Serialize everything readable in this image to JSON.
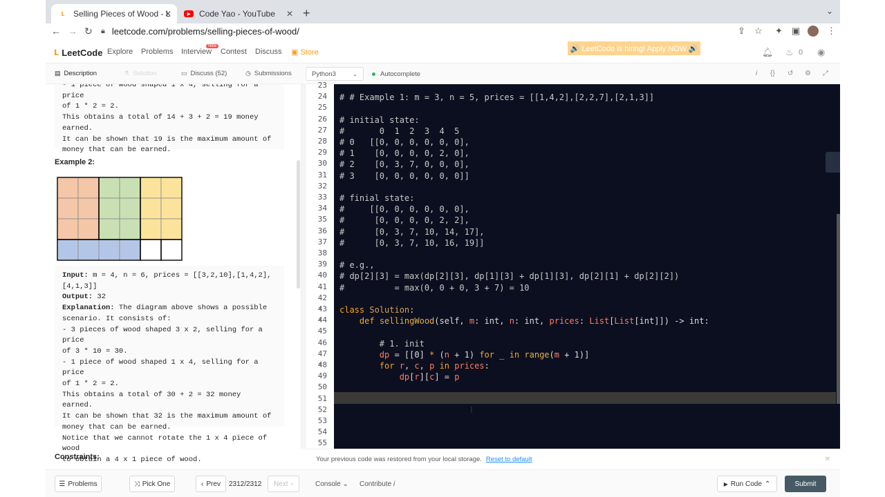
{
  "browser": {
    "tabs": [
      {
        "title": "Selling Pieces of Wood - LeetC",
        "active": true,
        "favicon": "leetcode-icon"
      },
      {
        "title": "Code Yao - YouTube",
        "active": false,
        "favicon": "youtube-icon"
      }
    ],
    "url": "leetcode.com/problems/selling-pieces-of-wood/"
  },
  "nav": {
    "logo": "LeetCode",
    "links": [
      "Explore",
      "Problems",
      "Interview",
      "Contest",
      "Discuss",
      "Store"
    ],
    "new_badge": "New",
    "hiring": "🔊 LeetCode is hiring! Apply NOW.🔊",
    "streak": "0"
  },
  "desc_tabs": {
    "description": "Description",
    "solution": "Solution",
    "discuss": "Discuss (52)",
    "submissions": "Submissions"
  },
  "editor_toolbar": {
    "language": "Python3",
    "autocomplete": "Autocomplete"
  },
  "description": {
    "example1_tail": "- 1 piece of wood shaped 1 x 4, selling for a price\nof 1 * 2 = 2.\nThis obtains a total of 14 + 3 + 2 = 19 money\nearned.\nIt can be shown that 19 is the maximum amount of\nmoney that can be earned.",
    "example2_heading": "Example 2:",
    "example2_input_label": "Input:",
    "example2_input": " m = 4, n = 6, prices = [[3,2,10],[1,4,2],\n[4,1,3]]",
    "example2_output_label": "Output:",
    "example2_output": " 32",
    "example2_expl_label": "Explanation:",
    "example2_expl": " The diagram above shows a possible\nscenario. It consists of:\n- 3 pieces of wood shaped 3 x 2, selling for a price\nof 3 * 10 = 30.\n- 1 piece of wood shaped 1 x 4, selling for a price\nof 1 * 2 = 2.\nThis obtains a total of 30 + 2 = 32 money earned.\nIt can be shown that 32 is the maximum amount of\nmoney that can be earned.\nNotice that we cannot rotate the 1 x 4 piece of wood\nto obtain a 4 x 1 piece of wood.",
    "constraints_heading": "Constraints:"
  },
  "code_lines": [
    {
      "n": "23",
      "tokens": []
    },
    {
      "n": "24",
      "tokens": [
        [
          "c-com",
          "# # Example 1: m = 3, n = 5, prices = [[1,4,2],[2,2,7],[2,1,3]]"
        ]
      ]
    },
    {
      "n": "25",
      "tokens": []
    },
    {
      "n": "26",
      "tokens": [
        [
          "c-com",
          "# initial state:"
        ]
      ]
    },
    {
      "n": "27",
      "tokens": [
        [
          "c-com",
          "#       0  1  2  3  4  5"
        ]
      ]
    },
    {
      "n": "28",
      "tokens": [
        [
          "c-com",
          "# 0   [[0, 0, 0, 0, 0, 0],"
        ]
      ]
    },
    {
      "n": "29",
      "tokens": [
        [
          "c-com",
          "# 1    [0, 0, 0, 0, 2, 0],"
        ]
      ]
    },
    {
      "n": "30",
      "tokens": [
        [
          "c-com",
          "# 2    [0, 3, 7, 0, 0, 0],"
        ]
      ]
    },
    {
      "n": "31",
      "tokens": [
        [
          "c-com",
          "# 3    [0, 0, 0, 0, 0, 0]]"
        ]
      ]
    },
    {
      "n": "32",
      "tokens": []
    },
    {
      "n": "33",
      "tokens": [
        [
          "c-com",
          "# finial state:"
        ]
      ]
    },
    {
      "n": "34",
      "tokens": [
        [
          "c-com",
          "#     [[0, 0, 0, 0, 0, 0],"
        ]
      ]
    },
    {
      "n": "35",
      "tokens": [
        [
          "c-com",
          "#      [0, 0, 0, 0, 2, 2],"
        ]
      ]
    },
    {
      "n": "36",
      "tokens": [
        [
          "c-com",
          "#      [0, 3, 7, 10, 14, 17],"
        ]
      ]
    },
    {
      "n": "37",
      "tokens": [
        [
          "c-com",
          "#      [0, 3, 7, 10, 16, 19]]"
        ]
      ]
    },
    {
      "n": "38",
      "tokens": []
    },
    {
      "n": "39",
      "tokens": [
        [
          "c-com",
          "# e.g.,"
        ]
      ]
    },
    {
      "n": "40",
      "tokens": [
        [
          "c-com",
          "# dp[2][3] = max(dp[2][3], dp[1][3] + dp[1][3], dp[2][1] + dp[2][2])"
        ]
      ]
    },
    {
      "n": "41",
      "tokens": [
        [
          "c-com",
          "#          = max(0, 0 + 0, 3 + 7) = 10"
        ]
      ]
    },
    {
      "n": "42",
      "tokens": []
    },
    {
      "n": "43",
      "fold": true,
      "tokens": [
        [
          "c-kw",
          "class "
        ],
        [
          "c-cls",
          "Solution"
        ],
        [
          "c-pl",
          ":"
        ]
      ]
    },
    {
      "n": "44",
      "fold": true,
      "tokens": [
        [
          "c-pl",
          "    "
        ],
        [
          "c-kw",
          "def "
        ],
        [
          "c-fn",
          "sellingWood"
        ],
        [
          "c-pl",
          "(self, "
        ],
        [
          "c-var",
          "m"
        ],
        [
          "c-pl",
          ": int, "
        ],
        [
          "c-var",
          "n"
        ],
        [
          "c-pl",
          ": int, "
        ],
        [
          "c-var",
          "prices"
        ],
        [
          "c-pl",
          ": "
        ],
        [
          "c-var",
          "List"
        ],
        [
          "c-pl",
          "["
        ],
        [
          "c-var",
          "List"
        ],
        [
          "c-pl",
          "[int]]) -> int:"
        ]
      ]
    },
    {
      "n": "45",
      "tokens": []
    },
    {
      "n": "46",
      "tokens": [
        [
          "c-pl",
          "        "
        ],
        [
          "c-com",
          "# 1. init"
        ]
      ]
    },
    {
      "n": "47",
      "tokens": [
        [
          "c-pl",
          "        "
        ],
        [
          "c-var",
          "dp"
        ],
        [
          "c-pl",
          " = [[0] "
        ],
        [
          "c-kw",
          "*"
        ],
        [
          "c-pl",
          " ("
        ],
        [
          "c-var",
          "n"
        ],
        [
          "c-pl",
          " + 1) "
        ],
        [
          "c-kw",
          "for"
        ],
        [
          "c-pl",
          " _ "
        ],
        [
          "c-kw",
          "in"
        ],
        [
          "c-pl",
          " "
        ],
        [
          "c-fn",
          "range"
        ],
        [
          "c-pl",
          "("
        ],
        [
          "c-var",
          "m"
        ],
        [
          "c-pl",
          " + 1)]"
        ]
      ]
    },
    {
      "n": "48",
      "fold": true,
      "tokens": [
        [
          "c-pl",
          "        "
        ],
        [
          "c-kw",
          "for"
        ],
        [
          "c-pl",
          " "
        ],
        [
          "c-var",
          "r"
        ],
        [
          "c-pl",
          ", "
        ],
        [
          "c-var",
          "c"
        ],
        [
          "c-pl",
          ", "
        ],
        [
          "c-var",
          "p"
        ],
        [
          "c-pl",
          " "
        ],
        [
          "c-kw",
          "in"
        ],
        [
          "c-pl",
          " "
        ],
        [
          "c-var",
          "prices"
        ],
        [
          "c-pl",
          ":"
        ]
      ]
    },
    {
      "n": "49",
      "tokens": [
        [
          "c-pl",
          "            "
        ],
        [
          "c-var",
          "dp"
        ],
        [
          "c-pl",
          "["
        ],
        [
          "c-var",
          "r"
        ],
        [
          "c-pl",
          "]["
        ],
        [
          "c-var",
          "c"
        ],
        [
          "c-pl",
          "] = "
        ],
        [
          "c-var",
          "p"
        ]
      ]
    },
    {
      "n": "50",
      "tokens": []
    },
    {
      "n": "51",
      "tokens": []
    },
    {
      "n": "52",
      "tokens": []
    },
    {
      "n": "53",
      "tokens": []
    },
    {
      "n": "54",
      "tokens": []
    },
    {
      "n": "55",
      "tokens": []
    }
  ],
  "notice": {
    "text": "Your previous code was restored from your local storage.",
    "link": "Reset to default"
  },
  "bottom": {
    "problems": "Problems",
    "pick_one": "Pick One",
    "prev": "Prev",
    "counter": "2312/2312",
    "next": "Next",
    "console": "Console",
    "contribute": "Contribute",
    "run_code": "Run Code",
    "submit": "Submit"
  },
  "colors": {
    "grid_orange": "#f4c7a8",
    "grid_green": "#c9e0b4",
    "grid_yellow": "#fbe39b",
    "grid_blue": "#b4c6e7",
    "editor_bg": "#0c0f1f",
    "brand": "#f89f1b"
  }
}
